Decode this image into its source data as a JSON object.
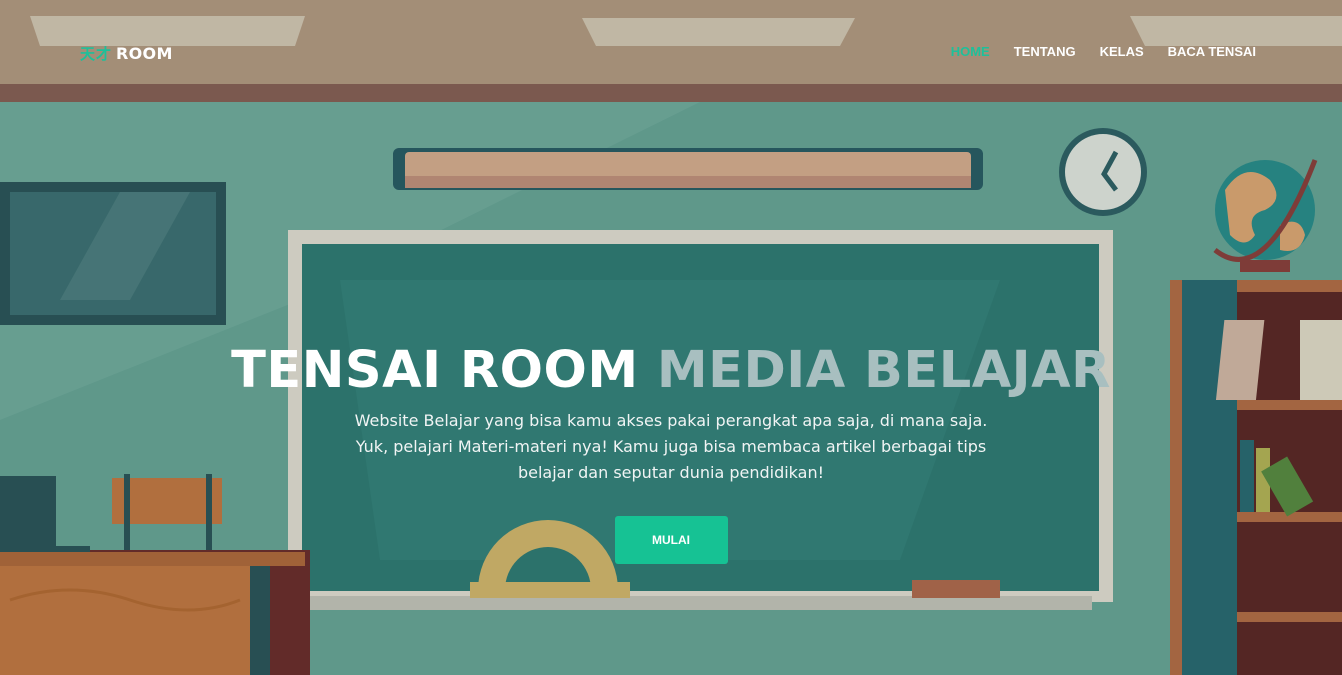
{
  "brand": {
    "kanji": "天才",
    "name": "ROOM",
    "accent_color": "#1ec09a"
  },
  "nav": {
    "items": [
      {
        "label": "HOME",
        "active": true
      },
      {
        "label": "TENTANG",
        "active": false
      },
      {
        "label": "KELAS",
        "active": false
      },
      {
        "label": "BACA TENSAI",
        "active": false
      }
    ]
  },
  "hero": {
    "title_part1": "TENSAI ROOM",
    "title_part2": "MEDIA BELAJAR",
    "description": "Website Belajar yang bisa kamu akses pakai perangkat apa saja, di mana saja. Yuk, pelajari Materi-materi nya! Kamu juga bisa membaca artikel berbagai tips belajar dan seputar dunia pendidikan!",
    "button_label": "MULAI",
    "button_color": "#16c294"
  },
  "background": {
    "description_icon": "classroom-illustration"
  }
}
